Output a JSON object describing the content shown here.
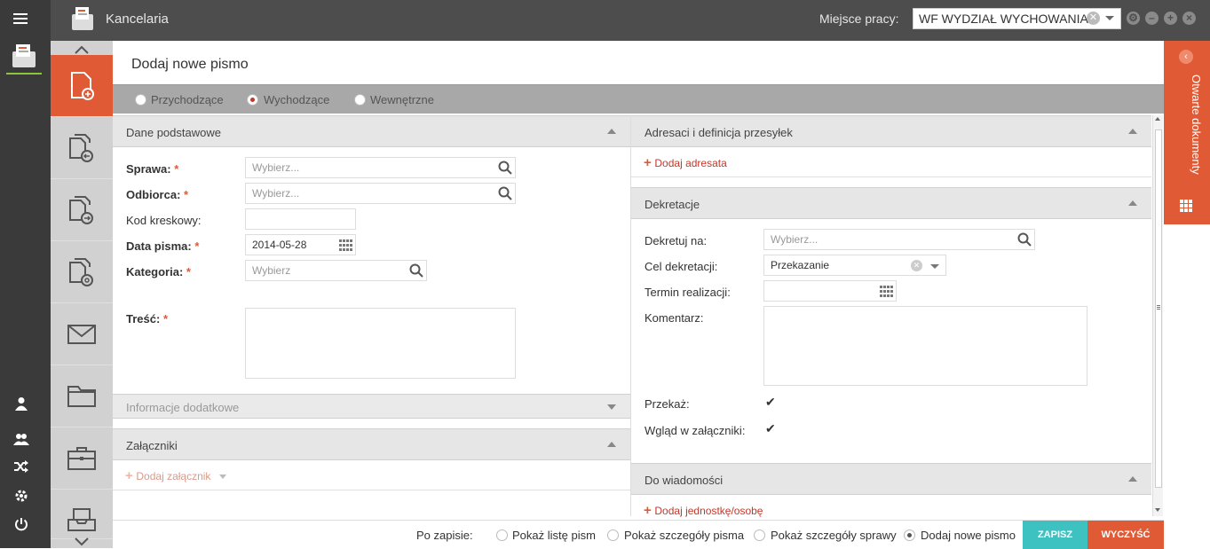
{
  "app": {
    "title": "Kancelaria"
  },
  "topbar": {
    "workplace_label": "Miejsce pracy:",
    "workplace_value": "WF WYDZIAŁ WYCHOWANIA"
  },
  "page": {
    "title": "Dodaj nowe pismo"
  },
  "types": [
    {
      "label": "Przychodzące",
      "selected": false
    },
    {
      "label": "Wychodzące",
      "selected": true
    },
    {
      "label": "Wewnętrzne",
      "selected": false
    }
  ],
  "basic": {
    "title": "Dane podstawowe",
    "sprawa_label": "Sprawa:",
    "sprawa_placeholder": "Wybierz...",
    "odbiorca_label": "Odbiorca:",
    "odbiorca_placeholder": "Wybierz...",
    "kod_label": "Kod kreskowy:",
    "data_label": "Data pisma:",
    "data_value": "2014-05-28",
    "kategoria_label": "Kategoria:",
    "kategoria_placeholder": "Wybierz",
    "tresc_label": "Treść:",
    "required_mark": "*"
  },
  "extra": {
    "title": "Informacje dodatkowe"
  },
  "attachments": {
    "title": "Załączniki",
    "add_label": "Dodaj załącznik"
  },
  "addressees": {
    "title": "Adresaci i definicja przesyłek",
    "add_label": "Dodaj adresata"
  },
  "decrees": {
    "title": "Dekretacje",
    "dekretuj_label": "Dekretuj na:",
    "dekretuj_placeholder": "Wybierz...",
    "cel_label": "Cel dekretacji:",
    "cel_value": "Przekazanie",
    "termin_label": "Termin realizacji:",
    "komentarz_label": "Komentarz:",
    "przekaz_label": "Przekaż:",
    "przekaz_checked": true,
    "wglad_label": "Wgląd w załączniki:",
    "wglad_checked": true
  },
  "info": {
    "title": "Do wiadomości",
    "add_label": "Dodaj jednostkę/osobę"
  },
  "bottom": {
    "after_save_label": "Po zapisie:",
    "options": [
      {
        "label": "Pokaż listę pism",
        "selected": false
      },
      {
        "label": "Pokaż szczegóły pisma",
        "selected": false
      },
      {
        "label": "Pokaż szczegóły sprawy",
        "selected": false
      },
      {
        "label": "Dodaj nowe pismo",
        "selected": true
      }
    ],
    "save_label": "ZAPISZ",
    "clear_label": "WYCZYŚĆ"
  },
  "rightpanel": {
    "label": "Otwarte dokumenty"
  },
  "colors": {
    "accent": "#e05a35",
    "save": "#3ec1c1",
    "topbar": "#4d4d4d",
    "sidebar": "#3a3a3a"
  }
}
